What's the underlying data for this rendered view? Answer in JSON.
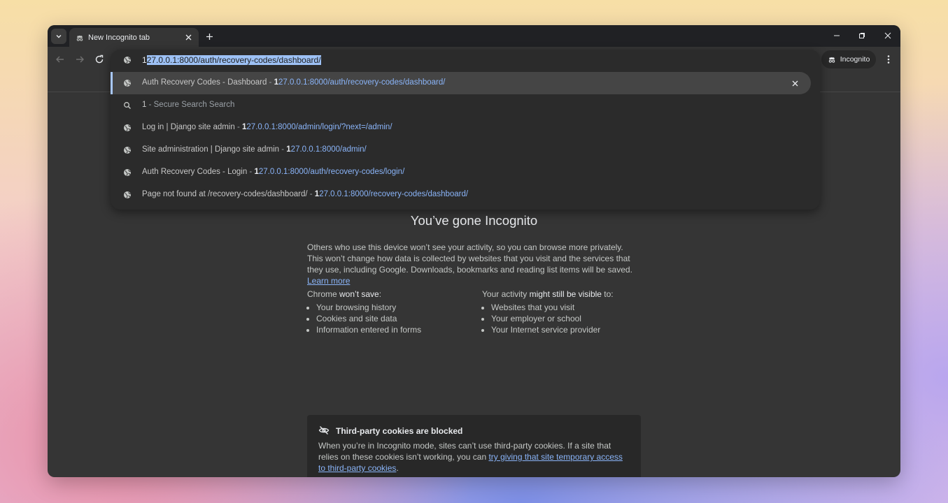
{
  "tab": {
    "title": "New Incognito tab",
    "icon": "incognito-icon"
  },
  "address_bar": {
    "prefix": "1",
    "selected": "27.0.0.1:8000/auth/recovery-codes/dashboard/"
  },
  "incognito_chip": {
    "label": "Incognito"
  },
  "suggestions": [
    {
      "icon": "globe-icon",
      "title": "Auth Recovery Codes - Dashboard",
      "sep": " - ",
      "url_bold": "1",
      "url_rest": "27.0.0.1:8000/auth/recovery-codes/dashboard/"
    },
    {
      "icon": "search-icon",
      "title": "1",
      "sep": " - ",
      "url_bold": "",
      "url_rest": "Secure Search Search"
    },
    {
      "icon": "globe-icon",
      "title": "Log in | Django site admin",
      "sep": " - ",
      "url_bold": "1",
      "url_rest": "27.0.0.1:8000/admin/login/?next=/admin/"
    },
    {
      "icon": "globe-icon",
      "title": "Site administration | Django site admin",
      "sep": " - ",
      "url_bold": "1",
      "url_rest": "27.0.0.1:8000/admin/"
    },
    {
      "icon": "globe-icon",
      "title": "Auth Recovery Codes - Login",
      "sep": " - ",
      "url_bold": "1",
      "url_rest": "27.0.0.1:8000/auth/recovery-codes/login/"
    },
    {
      "icon": "globe-icon",
      "title": "Page not found at /recovery-codes/dashboard/",
      "sep": " - ",
      "url_bold": "1",
      "url_rest": "27.0.0.1:8000/recovery-codes/dashboard/"
    }
  ],
  "page": {
    "heading": "You’ve gone Incognito",
    "intro": "Others who use this device won’t see your activity, so you can browse more privately. This won’t change how data is collected by websites that you visit and the services that they use, including Google. Downloads, bookmarks and reading list items will be saved.",
    "learn_more": "Learn more",
    "left_col": {
      "head_plain": "Chrome ",
      "head_bold": "won’t save",
      "head_end": ":",
      "items": [
        "Your browsing history",
        "Cookies and site data",
        "Information entered in forms"
      ]
    },
    "right_col": {
      "head_plain": "Your activity ",
      "head_bold": "might still be visible",
      "head_end": " to:",
      "items": [
        "Websites that you visit",
        "Your employer or school",
        "Your Internet service provider"
      ]
    },
    "cookies": {
      "title": "Third-party cookies are blocked",
      "body": "When you’re in Incognito mode, sites can’t use third-party cookies. If a site that relies on these cookies isn’t working, you can ",
      "link": "try giving that site temporary access to third-party cookies",
      "end": "."
    }
  },
  "colors": {
    "window_bg": "#353535",
    "tabstrip_bg": "#202124",
    "link": "#8ab4f8",
    "selection": "#9dc1f5"
  }
}
